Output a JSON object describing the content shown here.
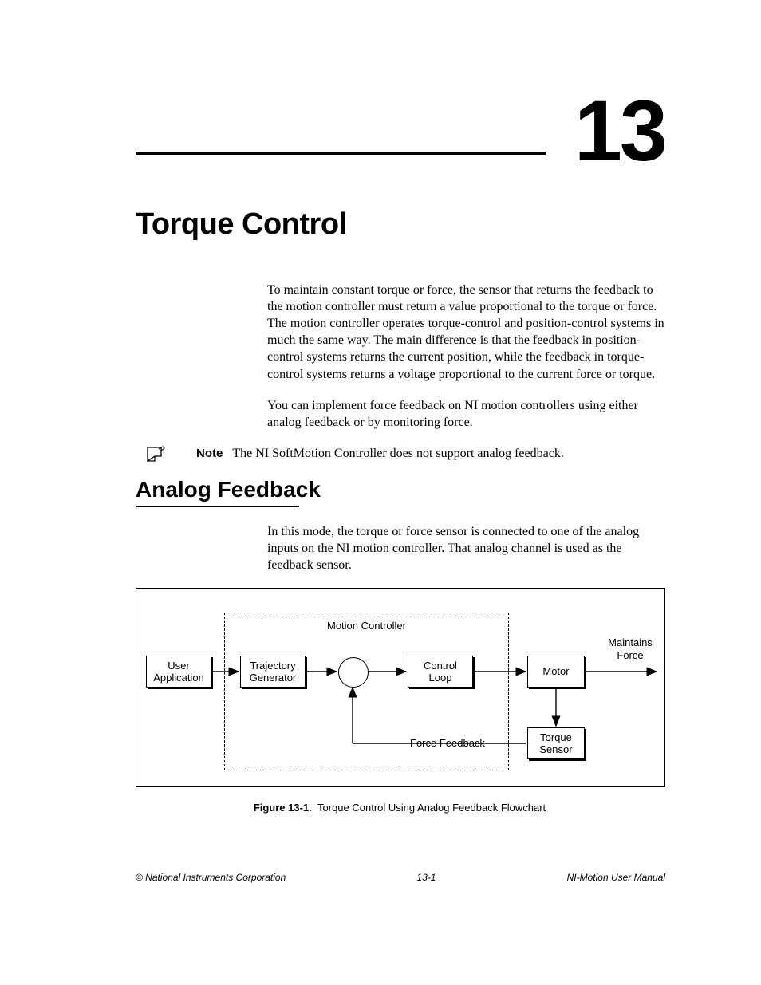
{
  "chapter": {
    "number": "13",
    "title": "Torque Control"
  },
  "intro": {
    "p1": "To maintain constant torque or force, the sensor that returns the feedback to the motion controller must return a value proportional to the torque or force. The motion controller operates torque-control and position-control systems in much the same way. The main difference is that the feedback in position-control systems returns the current position, while the feedback in torque-control systems returns a voltage proportional to the current force or torque.",
    "p2": "You can implement force feedback on NI motion controllers using either analog feedback or by monitoring force."
  },
  "note": {
    "label": "Note",
    "text": "The NI SoftMotion Controller does not support analog feedback."
  },
  "section": {
    "title": "Analog Feedback",
    "p1": "In this mode, the torque or force sensor is connected to one of the analog inputs on the NI motion controller. That analog channel is used as the feedback sensor."
  },
  "diagram": {
    "group_label": "Motion Controller",
    "user_app": "User\nApplication",
    "trajectory": "Trajectory\nGenerator",
    "control_loop": "Control\nLoop",
    "motor": "Motor",
    "torque_sensor": "Torque\nSensor",
    "maintains_force": "Maintains\nForce",
    "force_feedback": "Force Feedback"
  },
  "figure": {
    "label": "Figure 13-1.",
    "caption": "Torque Control Using Analog Feedback Flowchart"
  },
  "footer": {
    "left": "© National Instruments Corporation",
    "center": "13-1",
    "right": "NI-Motion User Manual"
  }
}
